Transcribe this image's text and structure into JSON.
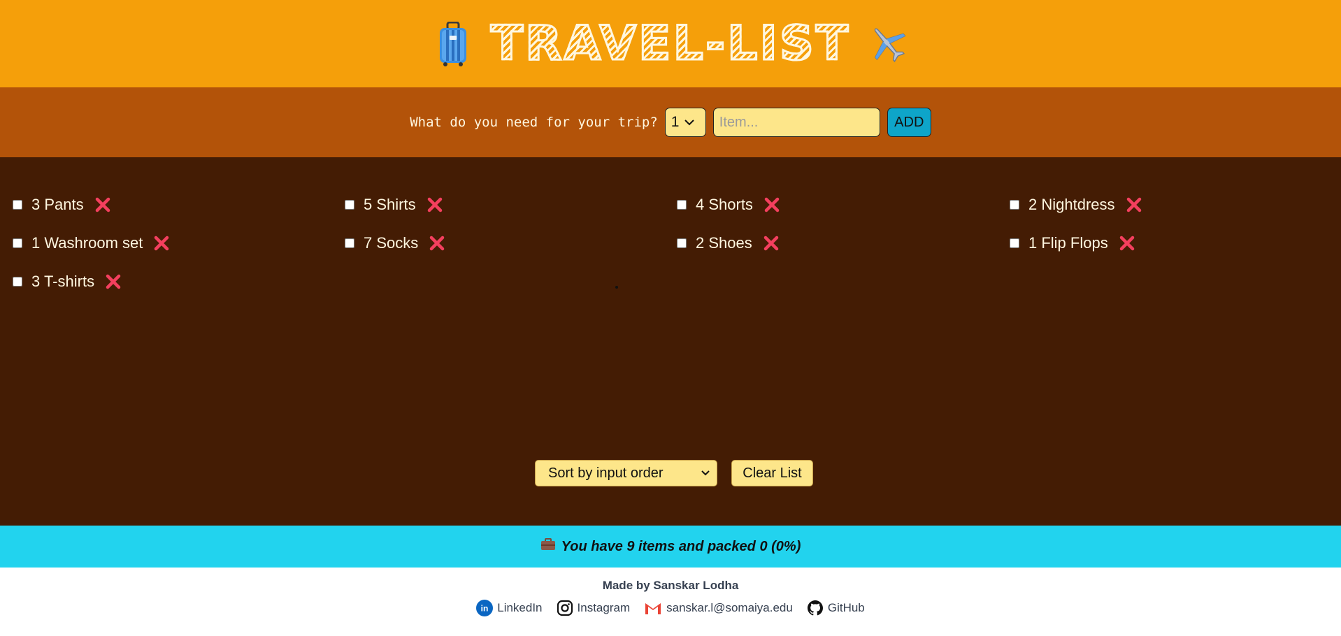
{
  "header": {
    "title": "TRAVEL-LIST",
    "left_icon": "suitcase-icon",
    "right_icon": "airplane-icon"
  },
  "form": {
    "label": "What do you need for your trip?",
    "quantity_value": "1",
    "item_placeholder": "Item...",
    "add_label": "ADD"
  },
  "items": [
    {
      "label": "3 Pants",
      "checked": false
    },
    {
      "label": "5 Shirts",
      "checked": false
    },
    {
      "label": "4 Shorts",
      "checked": false
    },
    {
      "label": "2 Nightdress",
      "checked": false
    },
    {
      "label": "1 Washroom set",
      "checked": false
    },
    {
      "label": "7 Socks",
      "checked": false
    },
    {
      "label": "2 Shoes",
      "checked": false
    },
    {
      "label": "1 Flip Flops",
      "checked": false
    },
    {
      "label": "3 T-shirts",
      "checked": false
    }
  ],
  "actions": {
    "sort_value": "Sort by input order",
    "clear_label": "Clear List"
  },
  "stats": {
    "icon": "briefcase-icon",
    "text": "You have 9 items and packed 0 (0%)"
  },
  "footer": {
    "made_by": "Made by Sanskar Lodha",
    "links": [
      {
        "label": "LinkedIn",
        "icon": "linkedin-icon"
      },
      {
        "label": "Instagram",
        "icon": "instagram-icon"
      },
      {
        "label": "sanskar.l@somaiya.edu",
        "icon": "gmail-icon"
      },
      {
        "label": "GitHub",
        "icon": "github-icon"
      }
    ]
  },
  "colors": {
    "header_bg": "#f59f0a",
    "form_bg": "#b35309",
    "list_bg": "#441c04",
    "stats_bg": "#22d3ee",
    "remove_icon": "#f43f5e"
  }
}
